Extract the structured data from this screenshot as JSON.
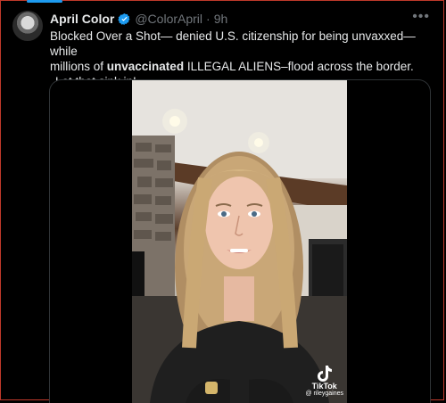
{
  "tweet": {
    "display_name": "April Color",
    "handle": "@ColorApril",
    "separator": "·",
    "time": "9h",
    "more_icon": "more-horizontal-icon",
    "text_line1": "Blocked Over a Shot— denied U.S. citizenship for being unvaxxed—while",
    "text_line2_pre": "millions of ",
    "text_line2_bold": "unvaccinated",
    "text_line2_post": " ILLEGAL ALIENS–flood across the border.",
    "text_line3": "Let that sink in!"
  },
  "video": {
    "watermark_brand": "TikTok",
    "watermark_user": "@ rileygaines"
  },
  "colors": {
    "verified": "#1d9bf0",
    "frame_border": "#c0392b",
    "background": "#000000"
  }
}
